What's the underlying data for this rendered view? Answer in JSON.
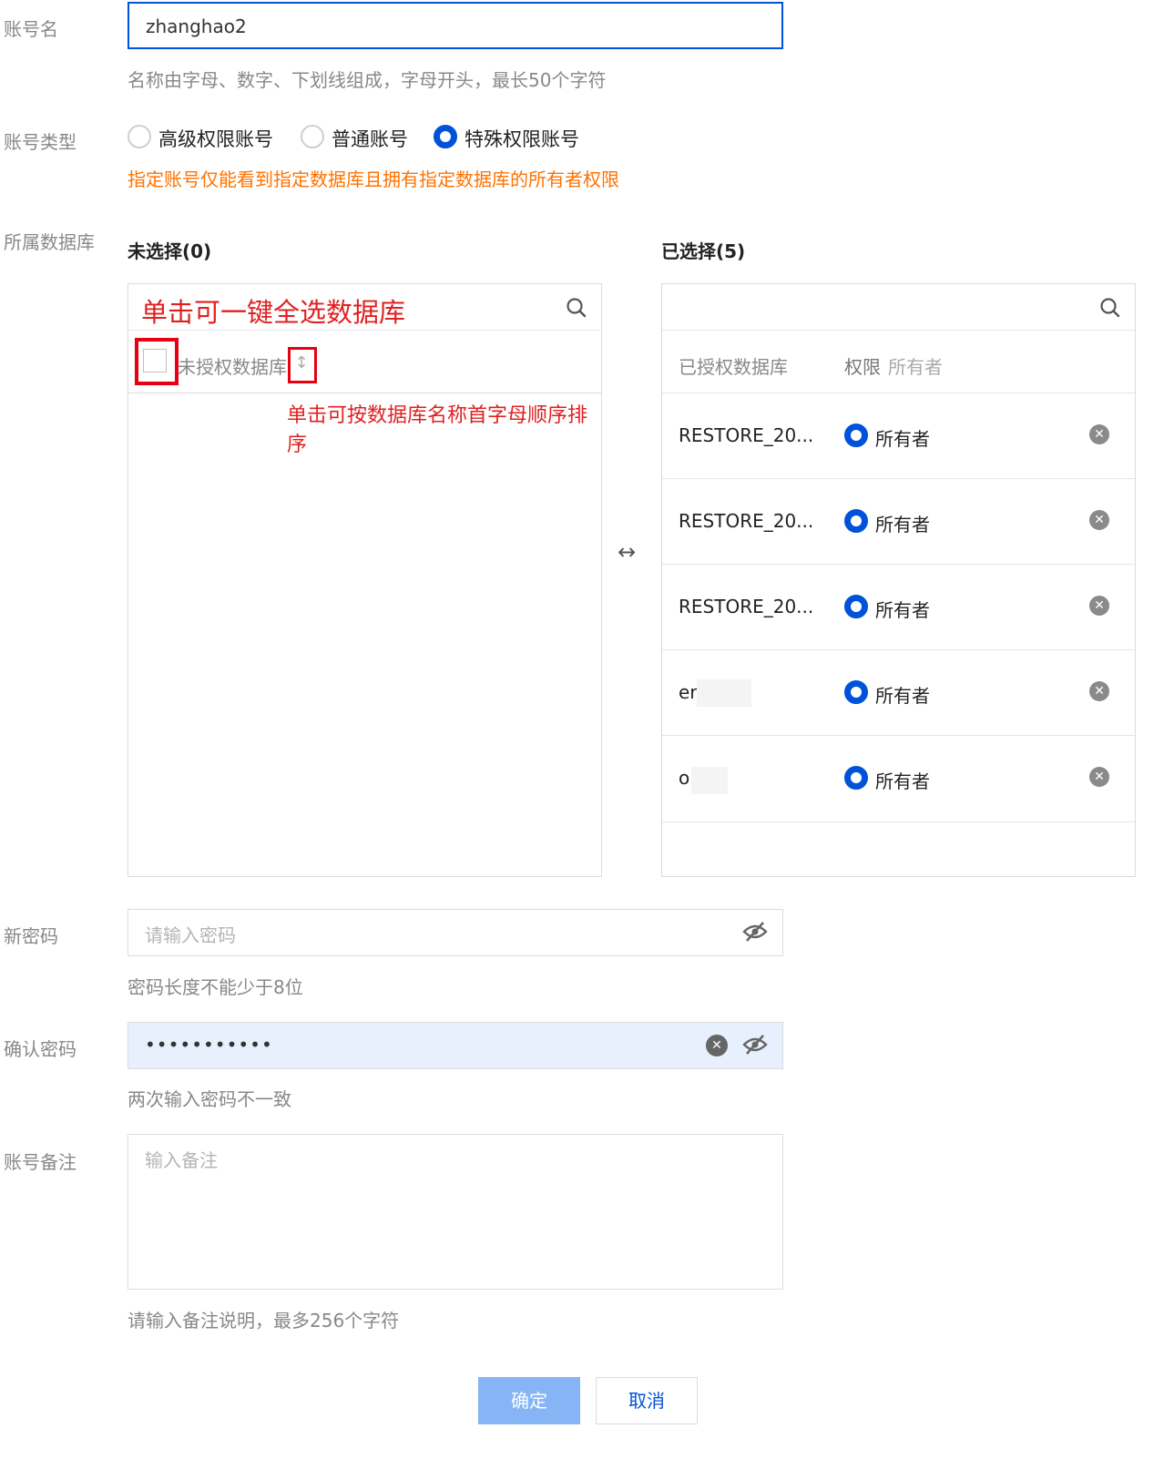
{
  "account_name": {
    "label": "账号名",
    "value": "zhanghao2",
    "help": "名称由字母、数字、下划线组成，字母开头，最长50个字符"
  },
  "account_type": {
    "label": "账号类型",
    "options": [
      {
        "label": "高级权限账号",
        "checked": false
      },
      {
        "label": "普通账号",
        "checked": false
      },
      {
        "label": "特殊权限账号",
        "checked": true
      }
    ],
    "warning": "指定账号仅能看到指定数据库且拥有指定数据库的所有者权限"
  },
  "database": {
    "label": "所属数据库",
    "unselected": {
      "title": "未选择(0)",
      "search_annotation": "单击可一键全选数据库",
      "column_header": "未授权数据库",
      "sort_annotation": "单击可按数据库名称首字母顺序排序"
    },
    "transfer_icon": "↔",
    "selected": {
      "title": "已选择(5)",
      "column_header": "已授权数据库",
      "perm_header": "权限",
      "perm_header_value": "所有者",
      "rows": [
        {
          "name": "RESTORE_20...",
          "perm": "所有者"
        },
        {
          "name": "RESTORE_20...",
          "perm": "所有者"
        },
        {
          "name": "RESTORE_20...",
          "perm": "所有者"
        },
        {
          "name": "er",
          "perm": "所有者"
        },
        {
          "name": "o",
          "perm": "所有者"
        }
      ]
    }
  },
  "new_password": {
    "label": "新密码",
    "placeholder": "请输入密码",
    "help": "密码长度不能少于8位"
  },
  "confirm_password": {
    "label": "确认密码",
    "value": "•••••••••••",
    "help": "两次输入密码不一致"
  },
  "remark": {
    "label": "账号备注",
    "placeholder": "输入备注",
    "help": "请输入备注说明，最多256个字符"
  },
  "buttons": {
    "confirm": "确定",
    "cancel": "取消"
  },
  "colors": {
    "primary": "#0052d9",
    "warning": "#ff7200",
    "annotation": "#e02020"
  }
}
